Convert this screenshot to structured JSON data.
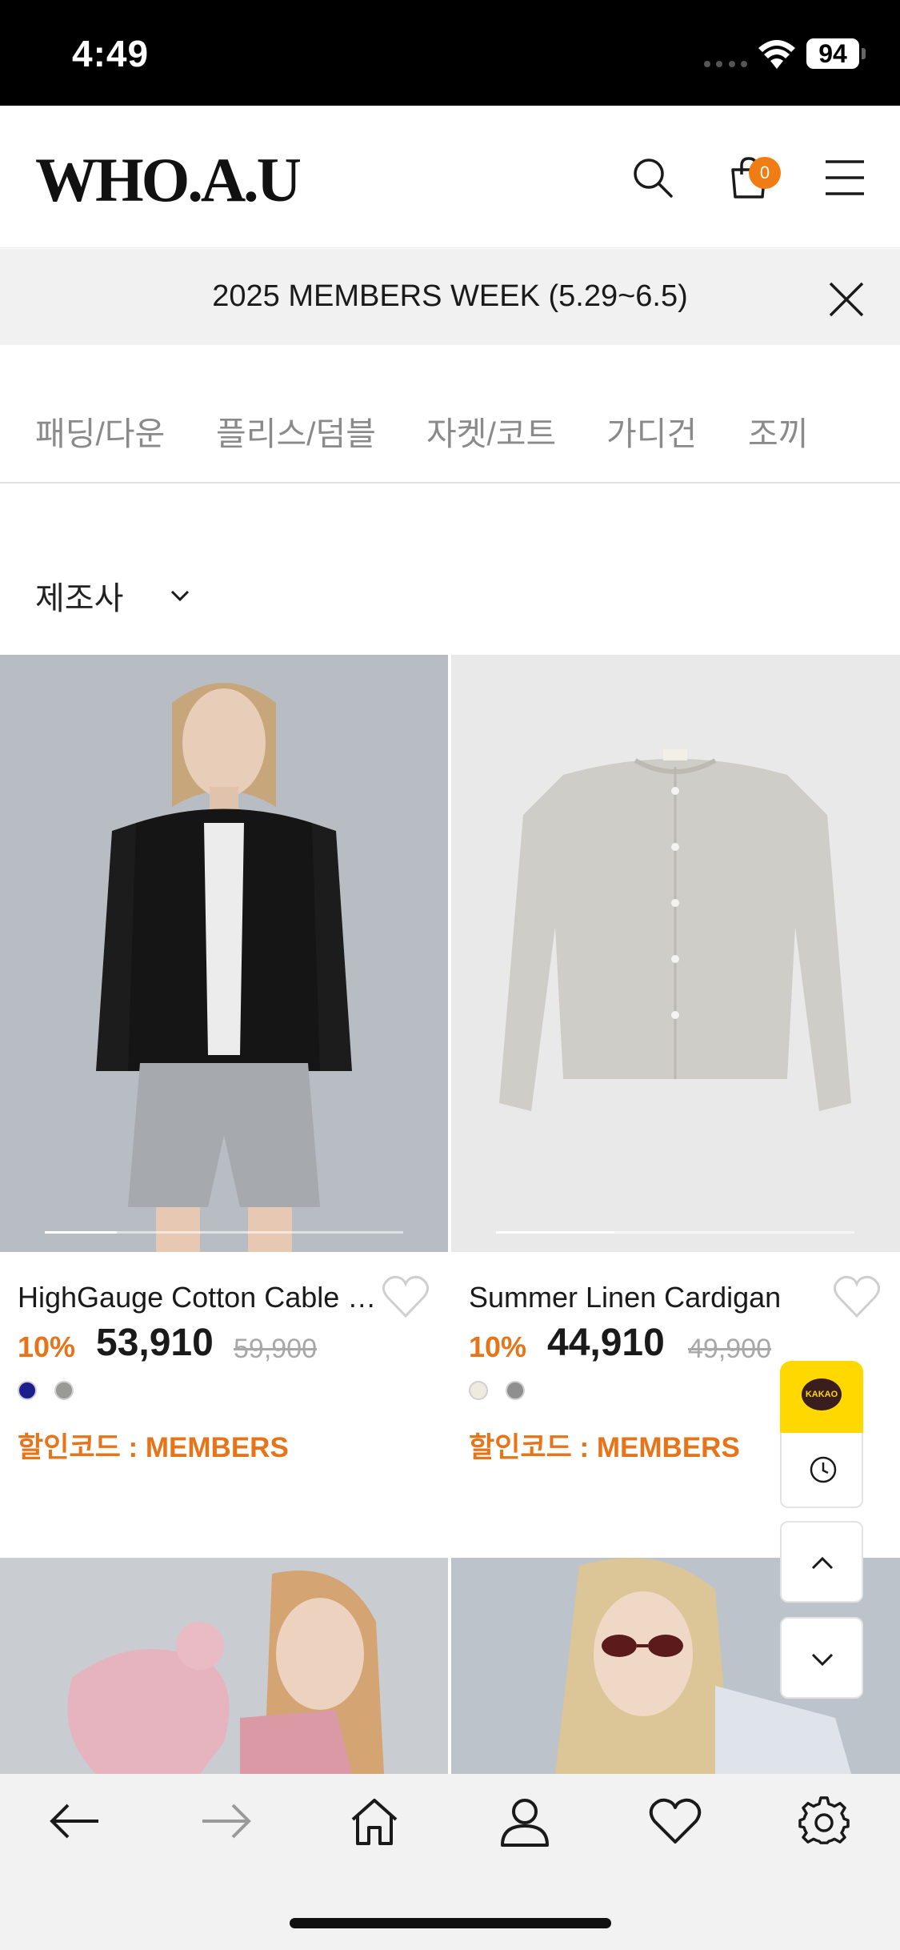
{
  "status_bar": {
    "time": "4:49",
    "battery": "94"
  },
  "header": {
    "logo": "WHO.A.U",
    "cart_count": "0",
    "icons": [
      "search-icon",
      "shopping-bag-icon",
      "hamburger-menu-icon"
    ]
  },
  "banner": {
    "text": "2025 MEMBERS WEEK (5.29~6.5)"
  },
  "categories": [
    "패딩/다운",
    "플리스/덤블",
    "자켓/코트",
    "가디건",
    "조끼"
  ],
  "filter": {
    "label": "제조사"
  },
  "products": [
    {
      "name": "HighGauge Cotton Cable Cardigan",
      "discount": "10%",
      "price": "53,910",
      "original_price": "59,900",
      "colors": [
        "#1b1f8c",
        "#9a9a94"
      ],
      "code": "할인코드 : MEMBERS",
      "image_progress": 0.2
    },
    {
      "name": "Summer Linen Cardigan",
      "discount": "10%",
      "price": "44,910",
      "original_price": "49,900",
      "colors": [
        "#efe9df",
        "#8f8f8f"
      ],
      "code": "할인코드 : MEMBERS",
      "image_progress": 0.33
    }
  ],
  "floating": {
    "kakao_label": "KAKAO"
  },
  "colors": {
    "accent": "#e8741a",
    "badge": "#f07d13",
    "kakao": "#ffd800"
  }
}
